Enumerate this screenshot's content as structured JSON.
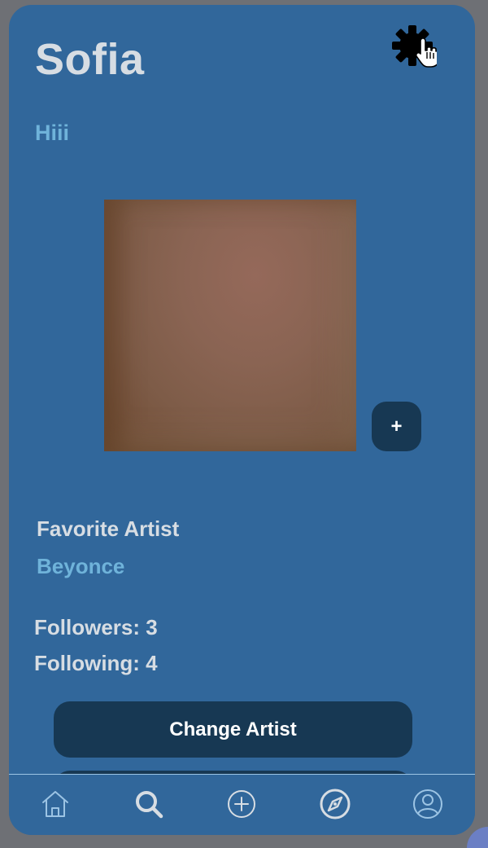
{
  "profile": {
    "name": "Sofia",
    "bio": "Hiii"
  },
  "header": {
    "settings_icon": "gear-icon",
    "cursor_icon": "hand-pointer-icon"
  },
  "photo": {
    "add_label": "+"
  },
  "favorite": {
    "label": "Favorite Artist",
    "artist": "Beyonce"
  },
  "stats": {
    "followers_text": "Followers: 3",
    "following_text": "Following: 4"
  },
  "actions": {
    "change_artist_label": "Change Artist"
  },
  "tabbar": {
    "items": [
      {
        "icon": "home-icon"
      },
      {
        "icon": "search-icon"
      },
      {
        "icon": "add-circle-icon"
      },
      {
        "icon": "compass-icon"
      },
      {
        "icon": "profile-icon"
      }
    ]
  },
  "colors": {
    "background": "#31679b",
    "button": "#173853",
    "accent_text": "#6fb3da",
    "primary_text": "#d7dde3"
  }
}
